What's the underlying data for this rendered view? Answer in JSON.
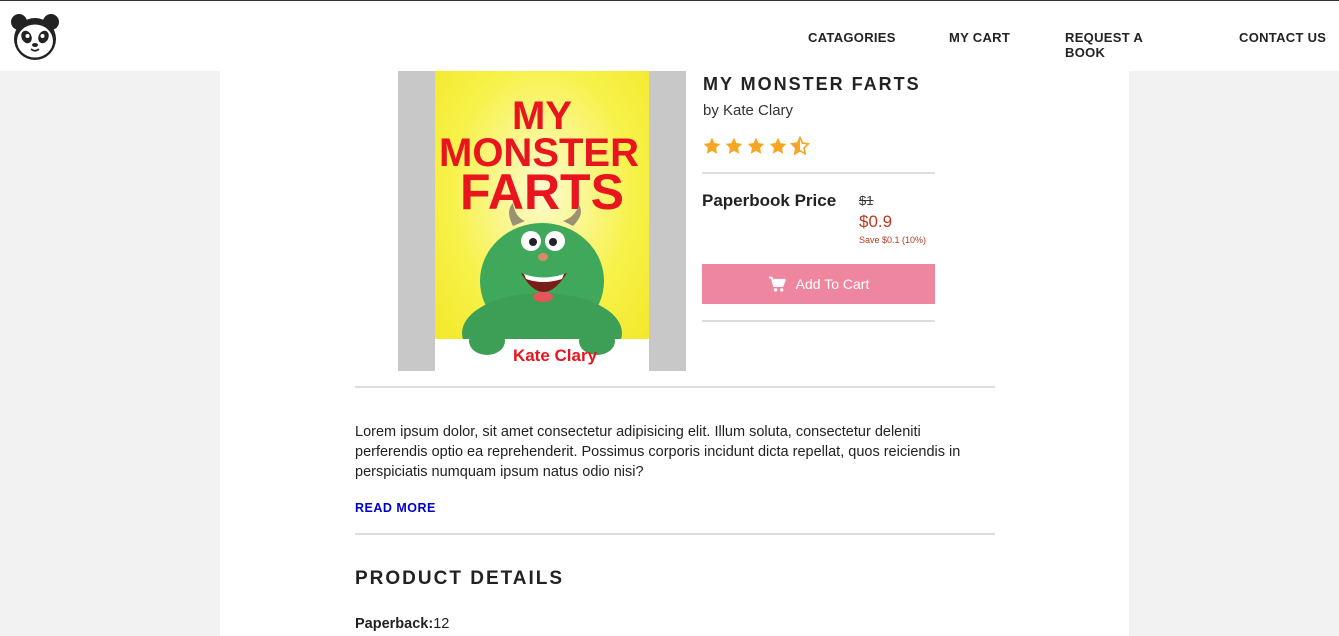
{
  "nav": {
    "links": [
      "CATAGORIES",
      "MY CART",
      "REQUEST A BOOK",
      "CONTACT US"
    ]
  },
  "book": {
    "title": "MY MONSTER FARTS",
    "author": "by Kate Clary",
    "rating": 4.5,
    "rating_max": 5,
    "cover": {
      "title_line1": "MY",
      "title_line2": "MONSTER",
      "title_line3": "FARTS",
      "author": "Kate Clary"
    },
    "price_label": "Paperbook Price",
    "old_price": "$1",
    "new_price": "$0.9",
    "save_note": "Save $0.1 (10%)",
    "add_to_cart": "Add To Cart"
  },
  "description": {
    "text": "Lorem ipsum dolor, sit amet consectetur adipisicing elit. Illum soluta, consectetur deleniti perferendis optio ea reprehenderit. Possimus corporis incidunt dicta repellat, quos reiciendis in perspiciatis numquam ipsum natus odio nisi?",
    "read_more": "READ MORE"
  },
  "details": {
    "heading": "PRODUCT DETAILS",
    "rows": [
      {
        "label": "Paperback:",
        "value": "12"
      }
    ]
  },
  "colors": {
    "star": "#f5a623",
    "button": "#ef86a0",
    "sale_price": "#b83a1f",
    "link": "#0000cc"
  },
  "icons": {
    "logo": "panda-logo-icon",
    "cart": "cart-icon",
    "star": "star-icon"
  }
}
